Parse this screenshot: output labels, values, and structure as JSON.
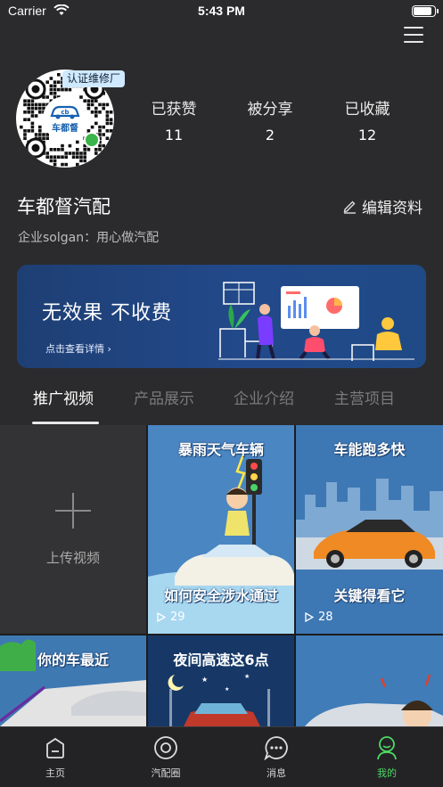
{
  "status_bar": {
    "carrier": "Carrier",
    "time": "5:43 PM",
    "battery_level": 0.9
  },
  "profile": {
    "qr_logo_text": "车都督",
    "cert_badge": "认证维修厂",
    "stats": [
      {
        "label": "已获赞",
        "value": "11"
      },
      {
        "label": "被分享",
        "value": "2"
      },
      {
        "label": "已收藏",
        "value": "12"
      }
    ],
    "company_name": "车都督汽配",
    "edit_label": "编辑资料",
    "slogan": "企业solgan：用心做汽配"
  },
  "banner": {
    "title": "无效果  不收费",
    "link": "点击查看详情 ›"
  },
  "tabs": [
    {
      "label": "推广视频",
      "active": true
    },
    {
      "label": "产品展示",
      "active": false
    },
    {
      "label": "企业介绍",
      "active": false
    },
    {
      "label": "主营项目",
      "active": false
    }
  ],
  "grid": {
    "upload_label": "上传视频",
    "videos": [
      {
        "title_top": "暴雨天气车辆",
        "title_bottom": "如何安全涉水通过",
        "plays": "29"
      },
      {
        "title_top": "车能跑多快",
        "title_bottom": "关键得看它",
        "plays": "28"
      },
      {
        "title_top": "你的车最近",
        "title_bottom": "",
        "plays": ""
      },
      {
        "title_top": "夜间高速这6点",
        "title_bottom": "",
        "plays": ""
      },
      {
        "title_top": "",
        "title_bottom": "",
        "plays": ""
      }
    ]
  },
  "tabbar": [
    {
      "label": "主页",
      "icon": "home-icon",
      "active": false
    },
    {
      "label": "汽配圈",
      "icon": "circle-icon",
      "active": false
    },
    {
      "label": "消息",
      "icon": "message-icon",
      "active": false
    },
    {
      "label": "我的",
      "icon": "user-icon",
      "active": true
    }
  ],
  "colors": {
    "accent_green": "#4cd964",
    "banner_blue": "#22498a",
    "tile_blue": "#3e78b4"
  }
}
